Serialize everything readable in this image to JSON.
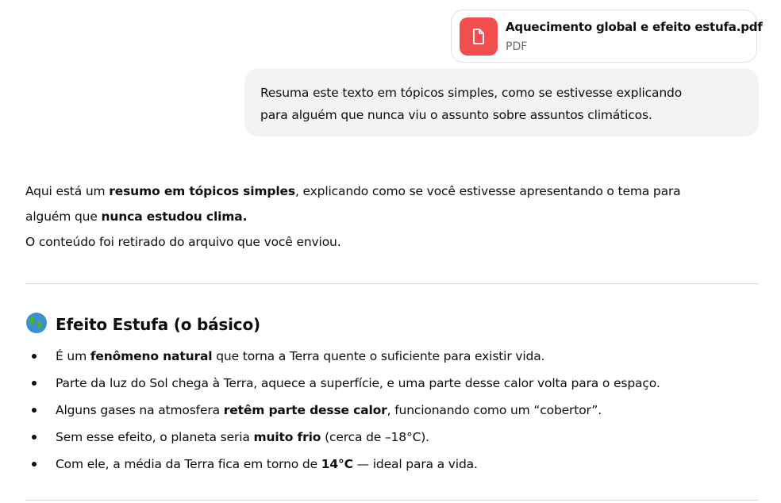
{
  "attachment": {
    "file_name": "Aquecimento global e efeito estufa.pdf",
    "file_type": "PDF",
    "icon": "file-icon",
    "icon_color": "#f34e4e"
  },
  "user_message": {
    "lines": [
      "Resuma este texto em tópicos simples, como se estivesse explicando",
      "para alguém que nunca viu o assunto sobre assuntos climáticos."
    ]
  },
  "assistant_intro": {
    "l1_a": "Aqui está um ",
    "l1_b": "resumo em tópicos simples",
    "l1_c": ", explicando como se você estivesse apresentando o tema para",
    "l2_a": "alguém que ",
    "l2_b": "nunca estudou clima.",
    "l3": "O conteúdo foi retirado do arquivo que você enviou."
  },
  "section": {
    "icon": "globe-icon",
    "heading": "Efeito Estufa (o básico)",
    "bullets": [
      {
        "a": "É um ",
        "b": "fenômeno natural",
        "c": " que torna a Terra quente o suficiente para existir vida."
      },
      {
        "a": "Parte da luz do Sol chega à Terra, aquece a superfície, e uma parte desse calor volta para o espaço.",
        "b": "",
        "c": ""
      },
      {
        "a": "Alguns gases na atmosfera ",
        "b": "retêm parte desse calor",
        "c": ", funcionando como um “cobertor”."
      },
      {
        "a": "Sem esse efeito, o planeta seria ",
        "b": "muito frio",
        "c": " (cerca de –18°C)."
      },
      {
        "a": "Com ele, a média da Terra fica em torno de ",
        "b": "14°C",
        "c": " — ideal para a vida."
      }
    ]
  }
}
